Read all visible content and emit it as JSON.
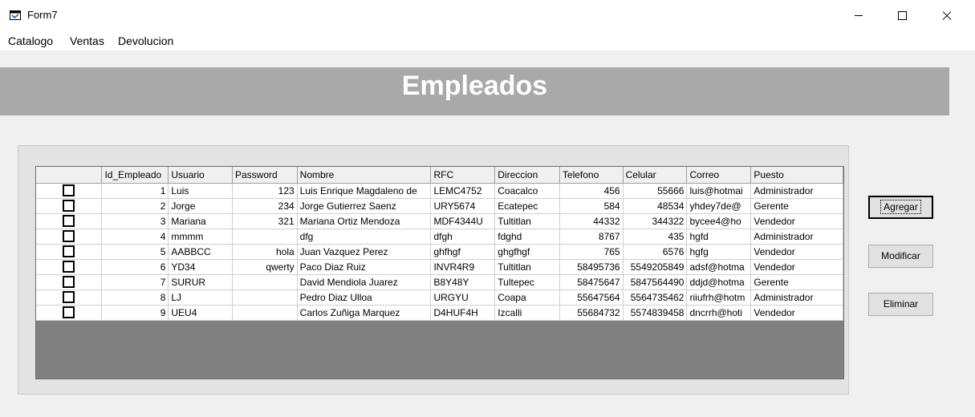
{
  "window": {
    "title": "Form7"
  },
  "menu": [
    "Catalogo",
    "Ventas",
    "Devolucion"
  ],
  "banner": {
    "title": "Empleados"
  },
  "grid": {
    "columns": [
      "",
      "Id_Empleado",
      "Usuario",
      "Password",
      "Nombre",
      "RFC",
      "Direccion",
      "Telefono",
      "Celular",
      "Correo",
      "Puesto"
    ],
    "rows": [
      [
        "",
        "1",
        "Luis",
        "123",
        "Luis Enrique Magdaleno de",
        "LEMC4752",
        "Coacalco",
        "456",
        "55666",
        "luis@hotmai",
        "Administrador"
      ],
      [
        "",
        "2",
        "Jorge",
        "234",
        "Jorge Gutierrez Saenz",
        "URY5674",
        "Ecatepec",
        "584",
        "48534",
        "yhdey7de@",
        "Gerente"
      ],
      [
        "",
        "3",
        "Mariana",
        "321",
        "Mariana Ortiz Mendoza",
        "MDF4344U",
        "Tultitlan",
        "44332",
        "344322",
        "bycee4@ho",
        "Vendedor"
      ],
      [
        "",
        "4",
        "mmmm",
        "",
        "dfg",
        "dfgh",
        "fdghd",
        "8767",
        "435",
        "hgfd",
        "Administrador"
      ],
      [
        "",
        "5",
        "AABBCC",
        "hola",
        "Juan Vazquez Perez",
        "ghfhgf",
        "ghgfhgf",
        "765",
        "6576",
        "hgfg",
        "Vendedor"
      ],
      [
        "",
        "6",
        "YD34",
        "qwerty",
        "Paco Diaz Ruiz",
        "INVR4R9",
        "Tultitlan",
        "58495736",
        "5549205849",
        "adsf@hotma",
        "Vendedor"
      ],
      [
        "",
        "7",
        "SURUR",
        "",
        "David Mendiola Juarez",
        "B8Y48Y",
        "Tultepec",
        "58475647",
        "5847564490",
        "ddjd@hotma",
        "Gerente"
      ],
      [
        "",
        "8",
        "LJ",
        "",
        "Pedro Diaz Ulloa",
        "URGYU",
        "Coapa",
        "55647564",
        "5564735462",
        "riiufrh@hotm",
        "Administrador"
      ],
      [
        "",
        "9",
        "UEU4",
        "",
        "Carlos Zuñiga Marquez",
        "D4HUF4H",
        "Izcalli",
        "55684732",
        "5574839458",
        "dncrrh@hoti",
        "Vendedor"
      ]
    ]
  },
  "buttons": {
    "agregar": "Agregar",
    "modificar": "Modificar",
    "eliminar": "Eliminar"
  }
}
